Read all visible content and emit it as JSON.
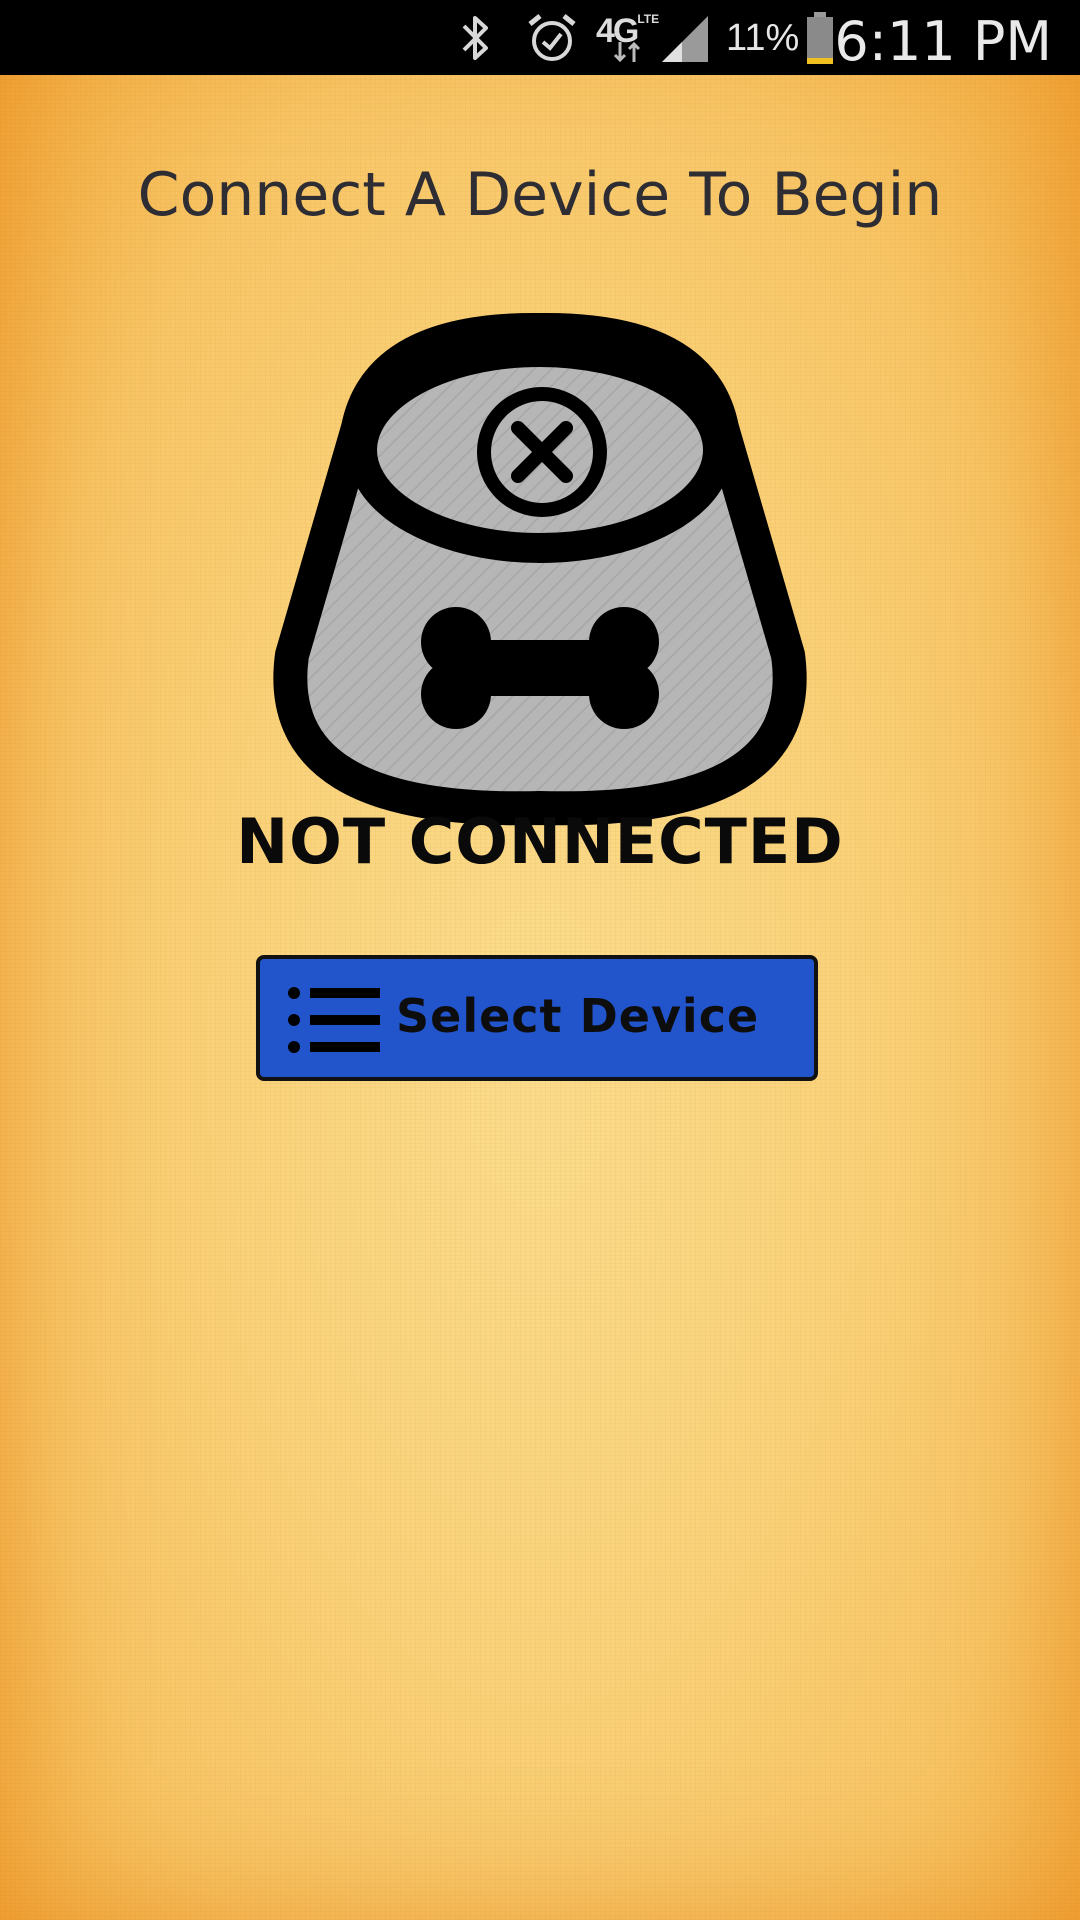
{
  "status_bar": {
    "network": "4G",
    "network_sub": "LTE",
    "battery_percent": "11%",
    "time": "6:11 PM",
    "icons": [
      "bluetooth-icon",
      "alarm-icon",
      "network-4g-lte-icon",
      "signal-icon",
      "battery-icon"
    ]
  },
  "main": {
    "title": "Connect A Device To Begin",
    "connection_status": "NOT CONNECTED",
    "status_image": "dog-bowl-disconnected-icon",
    "select_button": {
      "label": "Select Device",
      "icon": "list-icon"
    }
  },
  "colors": {
    "background": "#f9cc6e",
    "button": "#2254cc",
    "bowl_fill": "#b4b4b4",
    "outline": "#000000"
  }
}
